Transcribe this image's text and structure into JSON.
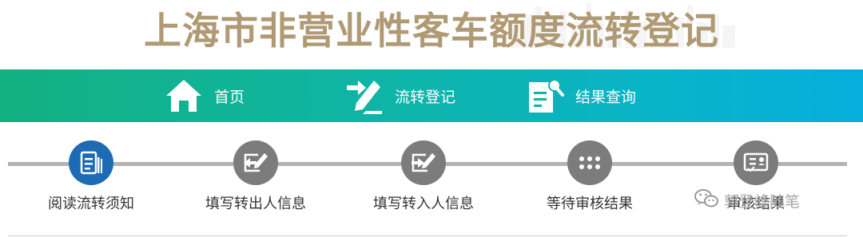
{
  "header": {
    "title": "上海市非营业性客车额度流转登记"
  },
  "nav": {
    "items": [
      {
        "label": "首页",
        "icon": "home-icon"
      },
      {
        "label": "流转登记",
        "icon": "edit-transfer-icon"
      },
      {
        "label": "结果查询",
        "icon": "document-search-icon"
      }
    ]
  },
  "steps": {
    "items": [
      {
        "label": "阅读流转须知",
        "icon": "notice-document-icon",
        "active": true
      },
      {
        "label": "填写转出人信息",
        "icon": "transfer-out-icon",
        "active": false
      },
      {
        "label": "填写转入人信息",
        "icon": "transfer-in-icon",
        "active": false
      },
      {
        "label": "等待审核结果",
        "icon": "dots-waiting-icon",
        "active": false
      },
      {
        "label": "审核结果",
        "icon": "id-card-icon",
        "active": false
      }
    ]
  },
  "watermark": {
    "text": "郭登峰随笔",
    "icon": "wechat-icon"
  },
  "colors": {
    "title": "#b09a74",
    "nav_start": "#13b081",
    "nav_end": "#06aedd",
    "step_active": "#1c6bb4",
    "step_inactive": "#7c7c7c",
    "track": "#b3b3b3"
  }
}
